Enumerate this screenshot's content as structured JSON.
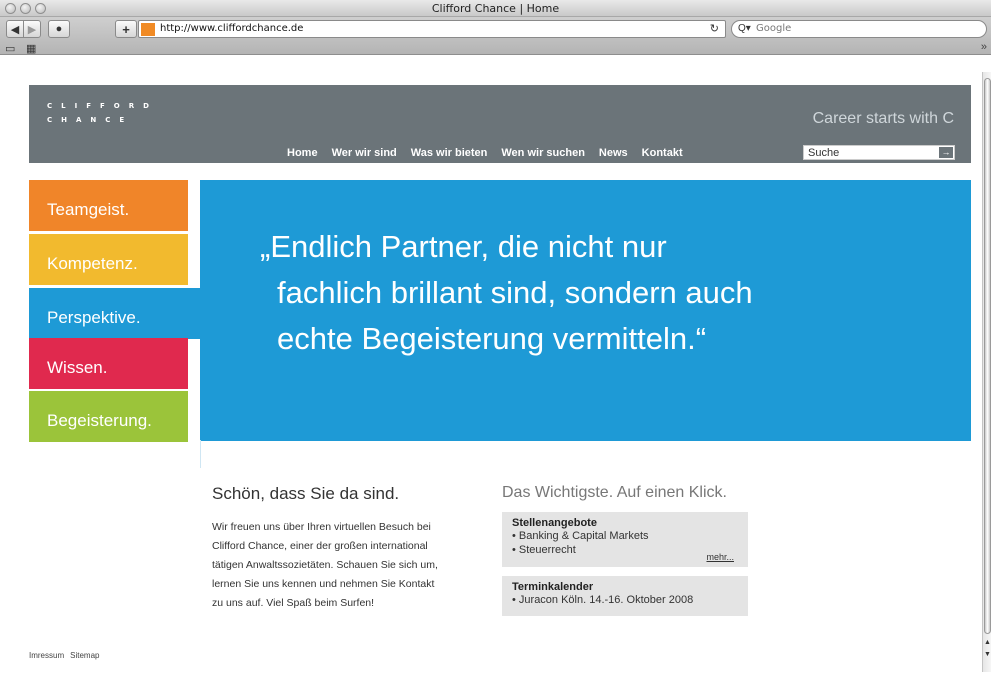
{
  "window": {
    "title": "Clifford Chance | Home"
  },
  "toolbar": {
    "url": "http://www.cliffordchance.de",
    "search_placeholder": "Google",
    "bookmarks_more": "»"
  },
  "header": {
    "logo_line1": "CLIFFORD",
    "logo_line2": "CHANCE",
    "tagline": "Career starts with C",
    "nav": [
      "Home",
      "Wer wir sind",
      "Was wir bieten",
      "Wen wir suchen",
      "News",
      "Kontakt"
    ],
    "search_placeholder": "Suche"
  },
  "tabs": [
    "Teamgeist.",
    "Kompetenz.",
    "Perspektive.",
    "Wissen.",
    "Begeisterung."
  ],
  "hero": {
    "quote_lines": [
      "„Endlich Partner, die nicht nur",
      "fachlich brillant sind, sondern auch",
      "echte Begeisterung vermitteln.“"
    ]
  },
  "welcome": {
    "title": "Schön, dass Sie da sind.",
    "lines": [
      "Wir freuen uns über Ihren virtuellen Besuch bei",
      "Clifford Chance, einer der großen international",
      "tätigen Anwaltssozietäten. Schauen Sie sich um,",
      "lernen Sie uns kennen und nehmen Sie Kontakt",
      "zu uns auf. Viel Spaß beim Surfen!"
    ]
  },
  "important": {
    "title": "Das Wichtigste. Auf einen Klick.",
    "jobs": {
      "title": "Stellenangebote",
      "items": [
        "• Banking & Capital Markets",
        "• Steuerrecht"
      ],
      "more": "mehr..."
    },
    "calendar": {
      "title": "Terminkalender",
      "items": [
        "• Juracon Köln. 14.-16. Oktober 2008"
      ]
    }
  },
  "footer": {
    "imprint": "Imressum",
    "sitemap": "Sitemap"
  },
  "colors": {
    "header_gray": "#6b7479",
    "teamgeist": "#f08529",
    "kompetenz": "#f2ba2e",
    "perspektive": "#1e9ad6",
    "wissen": "#e0294e",
    "begeisterung": "#9bc43a"
  }
}
